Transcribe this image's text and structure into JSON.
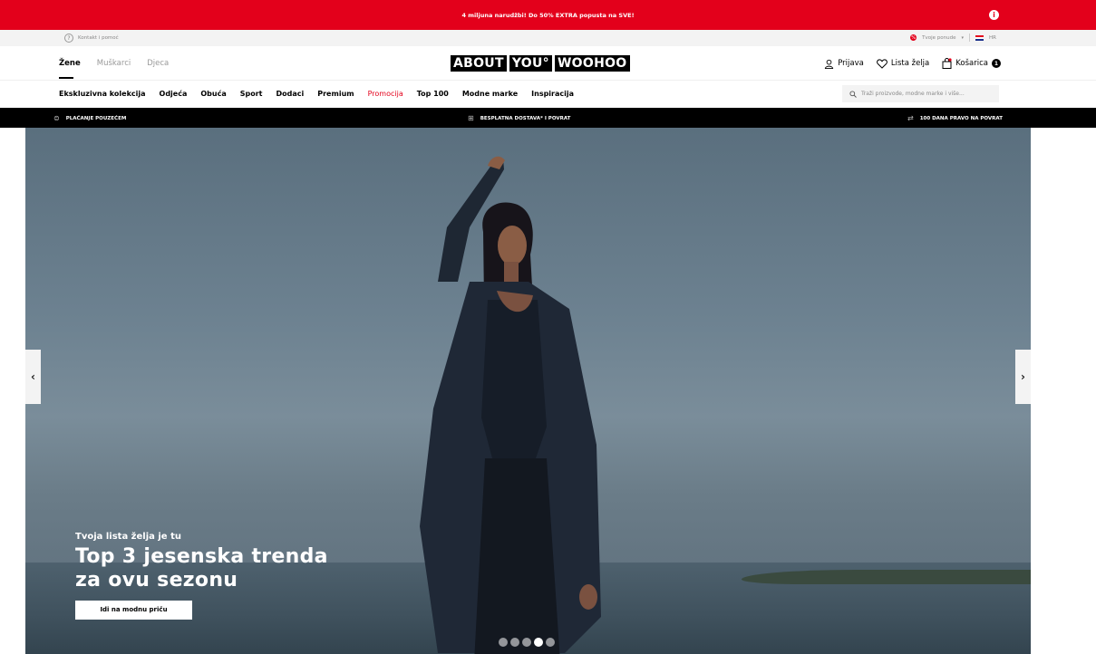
{
  "promo": {
    "text": "4 miljuna narudžbi! Do 50% EXTRA popusta na SVE!",
    "info_icon": "info-icon"
  },
  "utility": {
    "help_label": "Kontakt i pomoć",
    "offers_label": "Tvoje ponude",
    "language": "HR"
  },
  "header": {
    "gender_tabs": [
      "Žene",
      "Muškarci",
      "Djeca"
    ],
    "active_gender": "Žene",
    "logo": [
      "ABOUT",
      "YOU°",
      "WOOHOO"
    ],
    "login_label": "Prijava",
    "wishlist_label": "Lista želja",
    "cart_label": "Košarica",
    "cart_count": "1"
  },
  "nav": {
    "categories": [
      "Ekskluzivna kolekcija",
      "Odjeća",
      "Obuća",
      "Sport",
      "Dodaci",
      "Premium",
      "Promocija",
      "Top 100",
      "Modne marke",
      "Inspiracija"
    ],
    "search_placeholder": "Traži proizvode, modne marke i više..."
  },
  "usp": {
    "cod": "PLAĆANJE POUZEĆEM",
    "shipping": "BESPLATNA DOSTAVA* I POVRAT",
    "returns": "100 DANA PRAVO NA POVRAT"
  },
  "hero": {
    "subtitle": "Tvoja lista želja je tu",
    "title_line1": "Top 3 jesenska trenda",
    "title_line2": "za ovu sezonu",
    "cta": "Idi na modnu priču",
    "slide_count": 5,
    "active_slide": 4
  },
  "colors": {
    "brand_red": "#e3001b",
    "black": "#000000"
  }
}
